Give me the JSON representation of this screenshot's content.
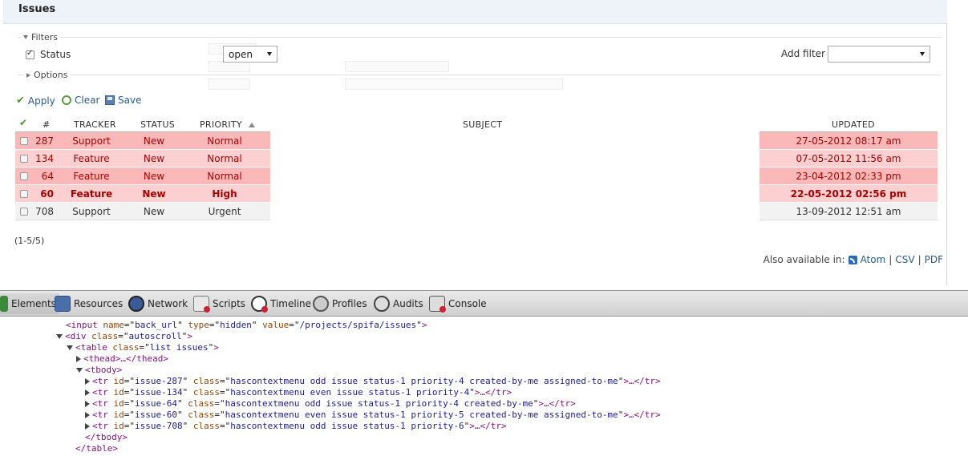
{
  "page": {
    "title": "Issues",
    "filters": {
      "legend": "Filters",
      "status_label": "Status",
      "status_operator": "open",
      "add_filter_label": "Add filter",
      "add_filter_value": ""
    },
    "options": {
      "legend": "Options"
    },
    "actions": {
      "apply": "Apply",
      "clear": "Clear",
      "save": "Save"
    },
    "table": {
      "headers": {
        "id": "#",
        "tracker": "TRACKER",
        "status": "STATUS",
        "priority": "PRIORITY",
        "subject": "SUBJECT",
        "updated": "UPDATED"
      },
      "rows": [
        {
          "id": "287",
          "tracker": "Support",
          "status": "New",
          "priority": "Normal",
          "updated": "27-05-2012 08:17 am"
        },
        {
          "id": "134",
          "tracker": "Feature",
          "status": "New",
          "priority": "Normal",
          "updated": "07-05-2012 11:56 am"
        },
        {
          "id": "64",
          "tracker": "Feature",
          "status": "New",
          "priority": "Normal",
          "updated": "23-04-2012 02:33 pm"
        },
        {
          "id": "60",
          "tracker": "Feature",
          "status": "New",
          "priority": "High",
          "updated": "22-05-2012 02:56 pm"
        },
        {
          "id": "708",
          "tracker": "Support",
          "status": "New",
          "priority": "Urgent",
          "updated": "13-09-2012 12:51 am"
        }
      ]
    },
    "count": "(1-5/5)",
    "also_available": {
      "label": "Also available in:",
      "atom": "Atom",
      "csv": "CSV",
      "pdf": "PDF",
      "sep": "|"
    }
  },
  "devtools": {
    "tabs": [
      "Elements",
      "Resources",
      "Network",
      "Scripts",
      "Timeline",
      "Profiles",
      "Audits",
      "Console"
    ],
    "dom": {
      "l0": {
        "tag": "input",
        "attrs": [
          [
            "name",
            "back_url"
          ],
          [
            "type",
            "hidden"
          ],
          [
            "value",
            "/projects/spifa/issues"
          ]
        ]
      },
      "l1": {
        "tag": "div",
        "attrs": [
          [
            "class",
            "autoscroll"
          ]
        ]
      },
      "l2": {
        "tag": "table",
        "attrs": [
          [
            "class",
            "list issues"
          ]
        ]
      },
      "l3": "<thead>…</thead>",
      "l4": "<tbody>",
      "rows": [
        {
          "id": "issue-287",
          "cls": "hascontextmenu odd issue status-1 priority-4 created-by-me assigned-to-me"
        },
        {
          "id": "issue-134",
          "cls": "hascontextmenu even issue status-1 priority-4"
        },
        {
          "id": "issue-64",
          "cls": "hascontextmenu odd issue status-1 priority-4 created-by-me"
        },
        {
          "id": "issue-60",
          "cls": "hascontextmenu even issue status-1 priority-5 created-by-me assigned-to-me"
        },
        {
          "id": "issue-708",
          "cls": "hascontextmenu odd issue status-1 priority-6"
        }
      ],
      "tbody_close": "</tbody>",
      "table_close": "</table>"
    }
  }
}
